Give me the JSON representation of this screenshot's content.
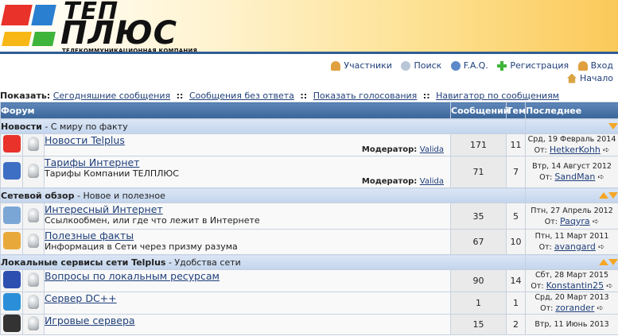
{
  "logo": {
    "line1": "ТЕП",
    "line2": "ПЛЮС",
    "tagline": "ТЕЛЕКОММУНИКАЦИОННАЯ КОМПАНИЯ"
  },
  "nav": {
    "members": "Участники",
    "search": "Поиск",
    "faq": "F.A.Q.",
    "register": "Регистрация",
    "login": "Вход",
    "home": "Начало"
  },
  "show": {
    "label": "Показать:",
    "links": [
      "Сегодняшние сообщения",
      "Сообщения без ответа",
      "Показать голосования",
      "Навигатор по сообщениям"
    ],
    "separator": "::"
  },
  "table": {
    "headers": {
      "forum": "Форум",
      "posts": "Сообщений",
      "topics": "Тем",
      "last": "Последнее"
    },
    "moderator_label": "Модератор:",
    "from_label": "От:",
    "categories": [
      {
        "name": "Новости",
        "desc": " - С миру по факту",
        "forums": [
          {
            "title": "Новости Telplus",
            "desc": "",
            "moderator": "Valida",
            "posts": "171",
            "topics": "11",
            "date": "Срд, 19 Февраль 2014",
            "author": "HetkerKohh",
            "icon_color": "#e8322a"
          },
          {
            "title": "Тарифы Интернет",
            "desc": "Тарифы Компании ТЕЛПЛЮС",
            "moderator": "Valida",
            "posts": "71",
            "topics": "7",
            "date": "Втр, 14 Август 2012",
            "author": "SandMan",
            "icon_color": "#3d6fc4"
          }
        ]
      },
      {
        "name": "Сетевой обзор",
        "desc": " - Новое и полезное",
        "forums": [
          {
            "title": "Интересный Интернет",
            "desc": "Ссылкообмен, или где что лежит в Интернете",
            "moderator": "",
            "posts": "35",
            "topics": "5",
            "date": "Птн, 27 Апрель 2012",
            "author": "Paqyra",
            "icon_color": "#7aa6d6"
          },
          {
            "title": "Полезные факты",
            "desc": "Информация в Сети через призму разума",
            "moderator": "",
            "posts": "67",
            "topics": "10",
            "date": "Птн, 11 Март 2011",
            "author": "avangard",
            "icon_color": "#e9a93a"
          }
        ]
      },
      {
        "name": "Локальные сервисы сети Telplus",
        "desc": " - Удобства сети",
        "forums": [
          {
            "title": "Вопросы по локальным ресурсам",
            "desc": "",
            "moderator": "",
            "posts": "90",
            "topics": "14",
            "date": "Сбт, 28 Март 2015",
            "author": "Konstantin25",
            "icon_color": "#2d4fb0"
          },
          {
            "title": "Сервер DC++",
            "desc": "",
            "moderator": "",
            "posts": "1",
            "topics": "1",
            "date": "Срд, 20 Март 2013",
            "author": "zorander",
            "icon_color": "#2a8fd8"
          },
          {
            "title": "Игровые сервера",
            "desc": "",
            "moderator": "",
            "posts": "15",
            "topics": "2",
            "date": "Втр, 11 Июнь 2013",
            "author": "",
            "icon_color": "#333333"
          }
        ]
      }
    ]
  }
}
